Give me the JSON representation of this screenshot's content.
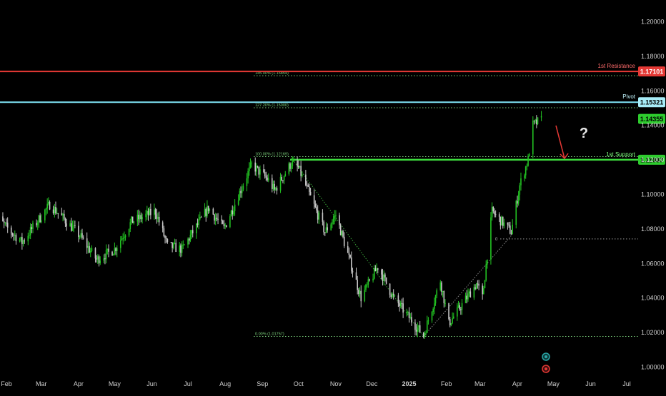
{
  "colors": {
    "background": "#000000",
    "up": "#22c222",
    "down": "#c8c8c8",
    "resistance": "#e53935",
    "pivot": "#7fe3f5",
    "support": "#3ddc3d",
    "fib": "#7bd17b",
    "arrow": "#e53935",
    "axis_text": "#d0d0d0"
  },
  "chart_data": {
    "type": "candlestick",
    "title": "",
    "ylim": [
      0.995,
      1.205
    ],
    "y_ticks": [
      "1.20000",
      "1.18000",
      "1.16000",
      "1.14000",
      "1.12000",
      "1.10000",
      "1.08000",
      "1.06000",
      "1.04000",
      "1.02000",
      "1.00000"
    ],
    "y_tick_values": [
      1.2,
      1.18,
      1.16,
      1.14,
      1.12,
      1.1,
      1.08,
      1.06,
      1.04,
      1.02,
      1.0
    ],
    "x_ticks": [
      "Feb",
      "Mar",
      "Apr",
      "May",
      "Jun",
      "Jul",
      "Aug",
      "Sep",
      "Oct",
      "Nov",
      "Dec",
      "2025",
      "Feb",
      "Mar",
      "Apr",
      "May",
      "Jun",
      "Jul"
    ],
    "x_tick_dates": [
      "2024-02-01",
      "2024-03-01",
      "2024-04-01",
      "2024-05-01",
      "2024-06-01",
      "2024-07-01",
      "2024-08-01",
      "2024-09-01",
      "2024-10-01",
      "2024-11-01",
      "2024-12-01",
      "2025-01-01",
      "2025-02-01",
      "2025-03-01",
      "2025-04-01",
      "2025-05-01",
      "2025-06-01",
      "2025-07-01"
    ],
    "series_path": [
      [
        "2024-01-22",
        1.088
      ],
      [
        "2024-02-05",
        1.078
      ],
      [
        "2024-02-14",
        1.072
      ],
      [
        "2024-03-08",
        1.094
      ],
      [
        "2024-04-02",
        1.076
      ],
      [
        "2024-04-16",
        1.062
      ],
      [
        "2024-05-01",
        1.068
      ],
      [
        "2024-05-15",
        1.084
      ],
      [
        "2024-06-04",
        1.09
      ],
      [
        "2024-06-14",
        1.07
      ],
      [
        "2024-06-26",
        1.068
      ],
      [
        "2024-07-18",
        1.092
      ],
      [
        "2024-07-31",
        1.08
      ],
      [
        "2024-08-23",
        1.117
      ],
      [
        "2024-09-06",
        1.108
      ],
      [
        "2024-09-11",
        1.102
      ],
      [
        "2024-09-25",
        1.118
      ],
      [
        "2024-10-01",
        1.115
      ],
      [
        "2024-10-23",
        1.078
      ],
      [
        "2024-11-01",
        1.088
      ],
      [
        "2024-11-22",
        1.04
      ],
      [
        "2024-12-06",
        1.058
      ],
      [
        "2024-12-19",
        1.04
      ],
      [
        "2025-01-13",
        1.018
      ],
      [
        "2025-01-27",
        1.05
      ],
      [
        "2025-02-03",
        1.025
      ],
      [
        "2025-02-26",
        1.048
      ],
      [
        "2025-03-03",
        1.04
      ],
      [
        "2025-03-11",
        1.09
      ],
      [
        "2025-03-27",
        1.078
      ],
      [
        "2025-04-03",
        1.105
      ],
      [
        "2025-04-10",
        1.12
      ],
      [
        "2025-04-14",
        1.14
      ],
      [
        "2025-04-21",
        1.143
      ]
    ],
    "last_label": "1.14355",
    "levels": [
      {
        "name": "1st Resistance",
        "value": 1.17101,
        "label": "1.17101",
        "style": "resistance"
      },
      {
        "name": "Pivot",
        "value": 1.15321,
        "label": "1.15321",
        "style": "pivot"
      },
      {
        "name": "1st Support",
        "value": 1.11987,
        "label": "1.11987",
        "style": "support"
      }
    ],
    "fib_levels": [
      {
        "label": "145.00% (1.16854)",
        "value": 1.16854
      },
      {
        "label": "127.20% (1.15000)",
        "value": 1.15
      },
      {
        "label": "100.00% (1.12169)",
        "value": 1.12169
      },
      {
        "label": "0.00% (1.01757)",
        "value": 1.01757
      }
    ],
    "zero_label": "0",
    "zero_level_value": 1.074,
    "question_mark": "?"
  }
}
